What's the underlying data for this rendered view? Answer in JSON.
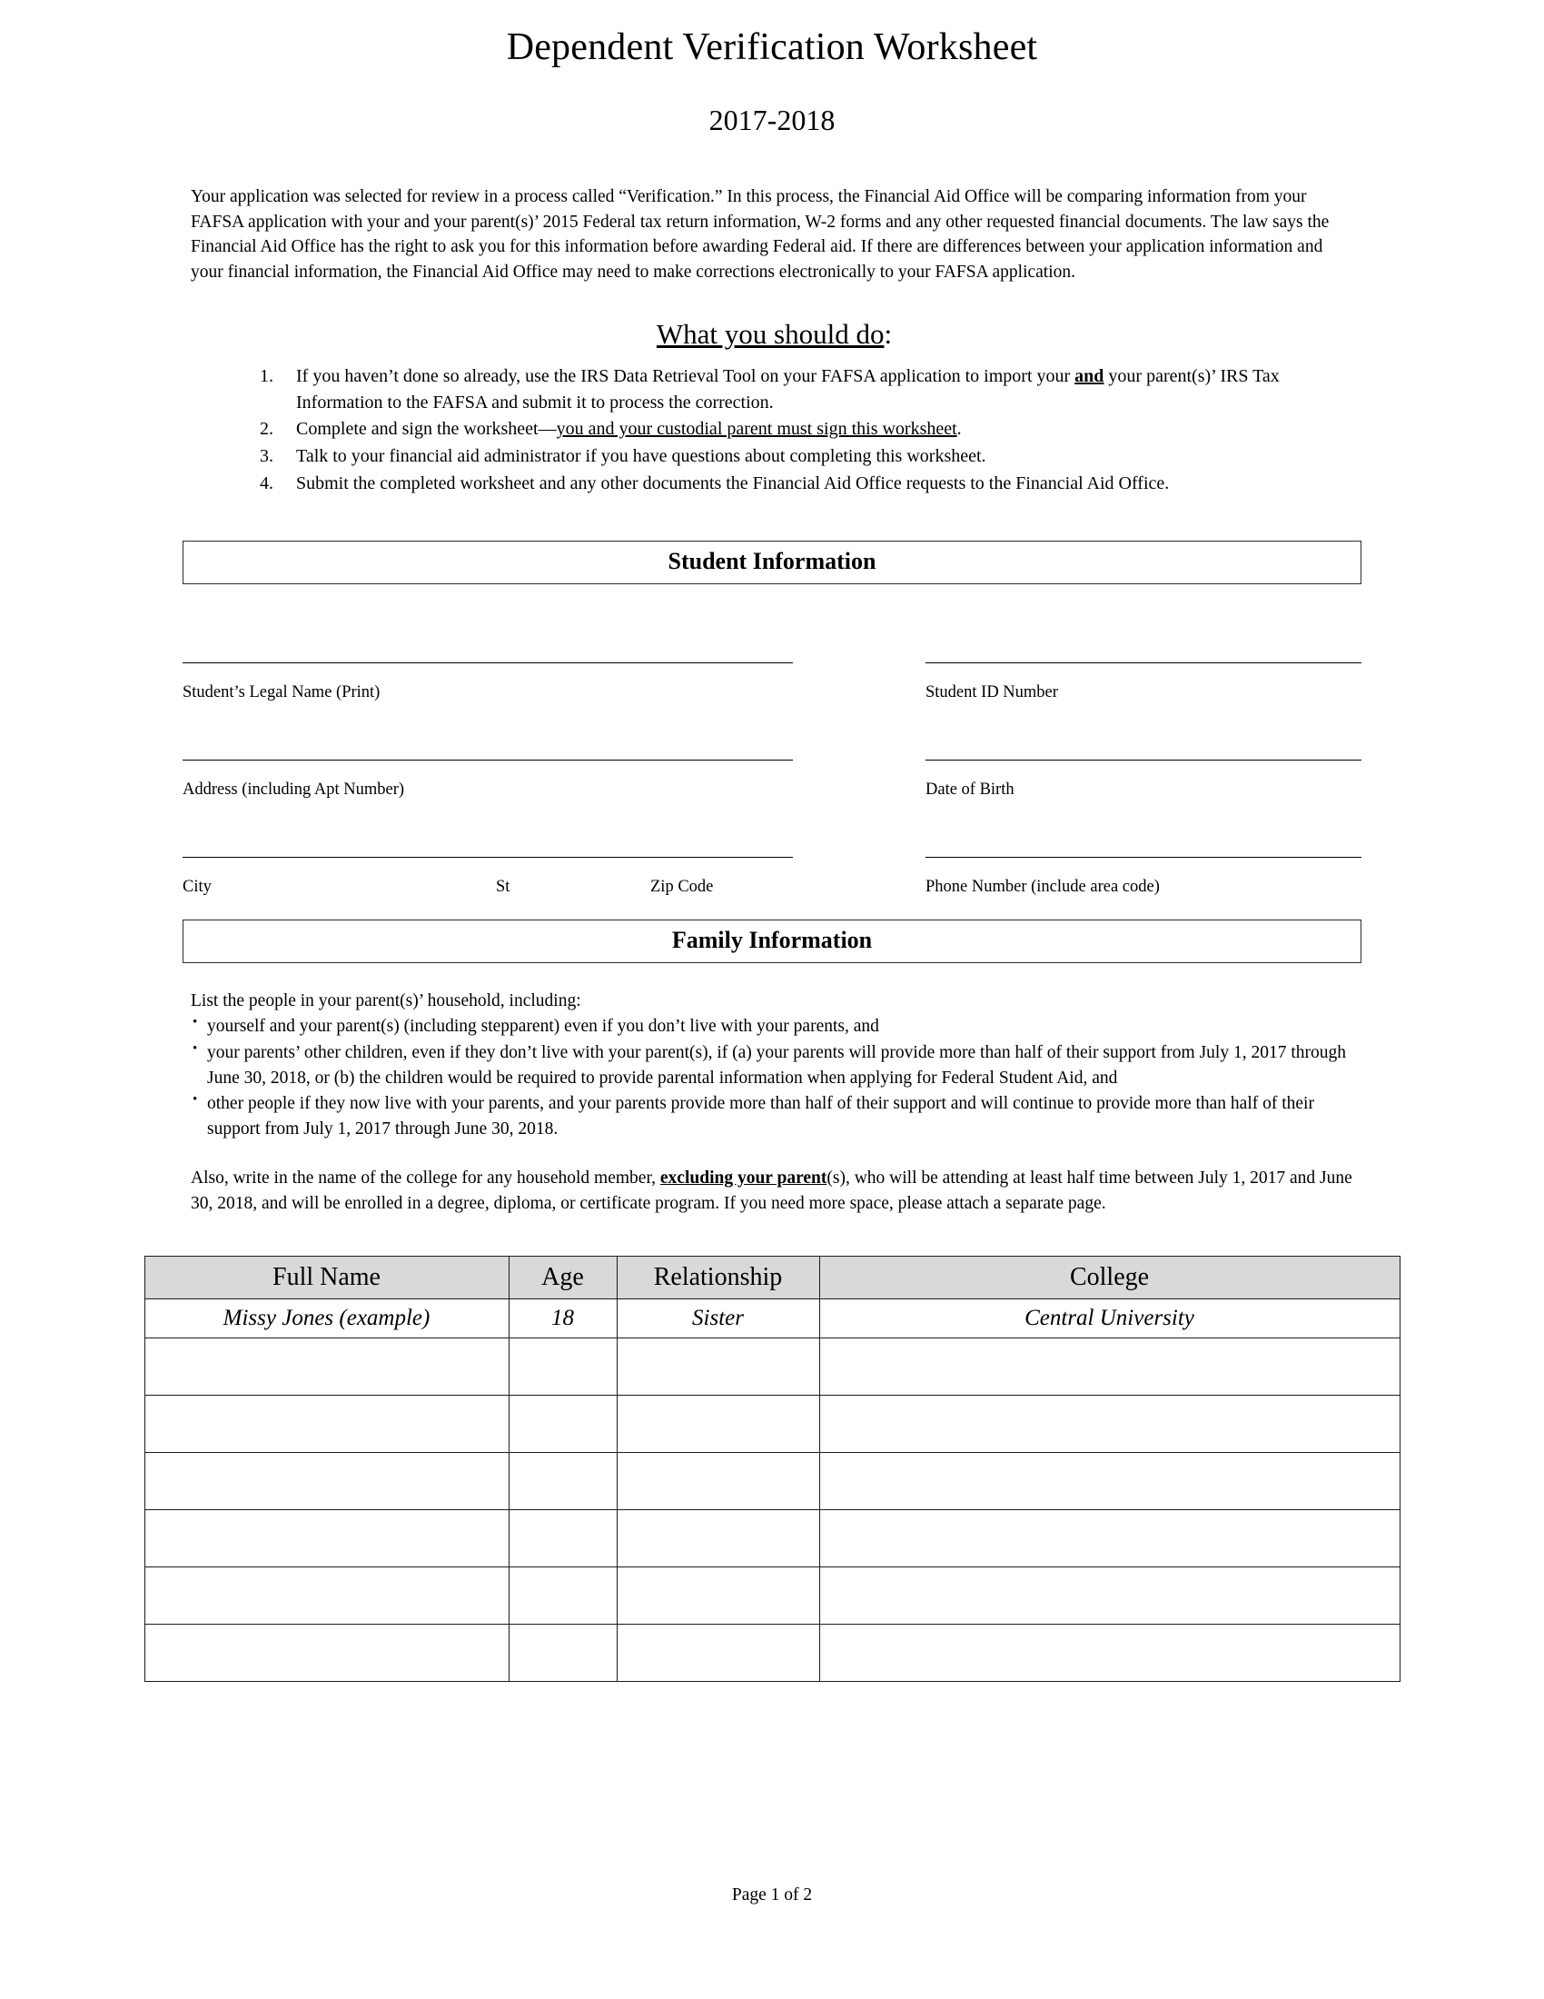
{
  "document": {
    "title": "Dependent Verification Worksheet",
    "year_range": "2017-2018",
    "footer": "Page 1 of 2"
  },
  "intro": {
    "paragraph": "Your application was selected for review in a process called “Verification.” In this process, the Financial Aid Office will be comparing information from your FAFSA application with your and your parent(s)’ 2015 Federal tax return information, W-2 forms and any other requested financial documents. The law says the Financial Aid Office has the right to ask you for this information before awarding Federal aid. If there are differences between your application information and your financial information, the Financial Aid Office may need to make corrections electronically to your FAFSA application."
  },
  "what_you_should_do": {
    "heading_underlined": "What you should do",
    "heading_suffix": ":",
    "steps": [
      {
        "prefix": "If you haven’t done so already, use the IRS Data Retrieval Tool on your FAFSA application to import your ",
        "emphasis": "and",
        "suffix": " your parent(s)’ IRS Tax Information to the FAFSA and submit it to process the correction."
      },
      {
        "prefix": "Complete and sign the worksheet—",
        "emphasis": "you and your custodial parent must sign this worksheet",
        "suffix": "."
      },
      {
        "prefix": "Talk to your financial aid administrator if you have questions about completing this worksheet.",
        "emphasis": "",
        "suffix": ""
      },
      {
        "prefix": "Submit the completed worksheet and any other documents the Financial Aid Office requests to the Financial Aid Office.",
        "emphasis": "",
        "suffix": ""
      }
    ]
  },
  "student_information": {
    "section_title": "Student Information",
    "fields": {
      "legal_name_label": "Student’s Legal Name (Print)",
      "legal_name_value": "",
      "student_id_label": "Student ID Number",
      "student_id_value": "",
      "address_label": "Address (including Apt Number)",
      "address_value": "",
      "dob_label": "Date of Birth",
      "dob_value": "",
      "city_label": "City",
      "city_value": "",
      "state_label": "St",
      "state_value": "",
      "zip_label": "Zip Code",
      "zip_value": "",
      "phone_label": "Phone Number (include area code)",
      "phone_value": ""
    }
  },
  "family_information": {
    "section_title": "Family Information",
    "lead_in": "List the people in your parent(s)’ household, including:",
    "bullets": [
      "yourself and your parent(s) (including stepparent) even if you don’t live with your parents, and",
      "your parents’ other children, even if they don’t live with your parent(s), if (a) your parents will provide more than half of their support from July 1, 2017 through June 30, 2018, or (b) the children would be required to provide parental information when applying for Federal Student Aid, and",
      "other people if they now live with your parents, and your parents provide more than half of their support and will continue to provide more than half of their support from July 1, 2017 through June 30, 2018."
    ],
    "also_paragraph": {
      "prefix": "Also, write in the name of the college for any household member, ",
      "emphasis": "excluding your parent",
      "suffix": "(s), who will be attending at least half time between July 1, 2017 and June 30, 2018, and will be enrolled in a degree, diploma, or certificate program. If you need more space, please attach a separate page."
    },
    "table": {
      "columns": [
        "Full Name",
        "Age",
        "Relationship",
        "College"
      ],
      "example_row": [
        "Missy Jones (example)",
        "18",
        "Sister",
        "Central University"
      ],
      "blank_row_count": 6
    }
  },
  "colors": {
    "text": "#000000",
    "page_background": "#ffffff",
    "table_header_fill": "#d9d9d9",
    "rule": "#000000",
    "section_border": "#2b2b2b"
  }
}
